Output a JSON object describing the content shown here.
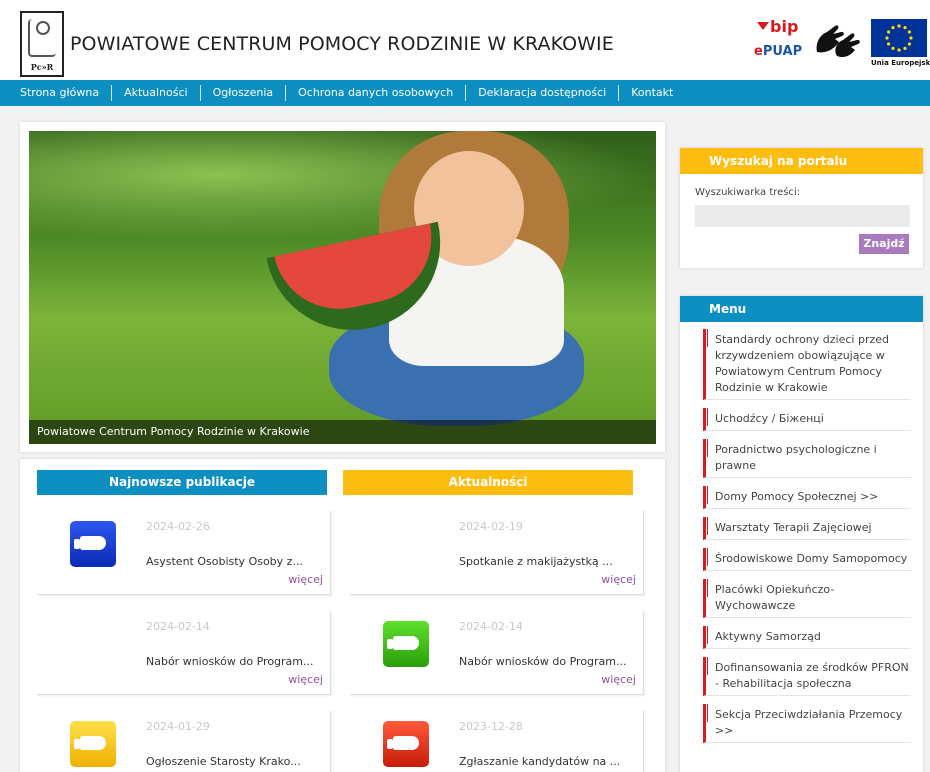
{
  "header": {
    "logo_text": "Pc»R",
    "title": "POWIATOWE CENTRUM POMOCY RODZINIE W KRAKOWIE",
    "bip_label": "bip",
    "epuap_prefix": "e",
    "epuap_label": "PUAP",
    "eu_caption": "Unia Europejska"
  },
  "nav": {
    "items": [
      "Strona główna",
      "Aktualności",
      "Ogłoszenia",
      "Ochrona danych osobowych",
      "Deklaracja dostępności",
      "Kontakt"
    ]
  },
  "hero": {
    "caption": "Powiatowe Centrum Pomocy Rodzinie w Krakowie"
  },
  "publications": {
    "left_header": "Najnowsze publikacje",
    "right_header": "Aktualności",
    "more_label": "więcej",
    "left": [
      {
        "date": "2024-02-26",
        "title": "Asystent Osobisty Osoby z...",
        "icon": "blue"
      },
      {
        "date": "2024-02-14",
        "title": "Nabór wniosków do Program...",
        "icon": ""
      },
      {
        "date": "2024-01-29",
        "title": "Ogłoszenie Starosty Krako...",
        "icon": "yellow"
      }
    ],
    "right": [
      {
        "date": "2024-02-19",
        "title": "Spotkanie z makijażystką ...",
        "icon": ""
      },
      {
        "date": "2024-02-14",
        "title": "Nabór wniosków do Program...",
        "icon": "green"
      },
      {
        "date": "2023-12-28",
        "title": "Zgłaszanie kandydatów na ...",
        "icon": "red"
      }
    ]
  },
  "search": {
    "title": "Wyszukaj na portalu",
    "label": "Wyszukiwarka treści:",
    "value": "",
    "button": "Znajdź"
  },
  "menu": {
    "title": "Menu",
    "items": [
      "Standardy ochrony dzieci przed krzywdzeniem obowiązujące w Powiatowym Centrum Pomocy Rodzinie w Krakowie",
      "Uchodźcy / Біженці",
      "Poradnictwo psychologiczne i prawne",
      "Domy Pomocy Społecznej >>",
      "Warsztaty Terapii Zajęciowej",
      "Środowiskowe Domy Samopomocy",
      "Placówki Opiekuńczo-Wychowawcze",
      "Aktywny Samorząd",
      "Dofinansowania ze środków PFRON - Rehabilitacja społeczna",
      "Sekcja Przeciwdziałania Przemocy >>"
    ]
  },
  "colors": {
    "primary_blue": "#0d8fc1",
    "accent_yellow": "#fdbd10",
    "link_purple": "#8e4f9a",
    "menu_red": "#d71920"
  }
}
